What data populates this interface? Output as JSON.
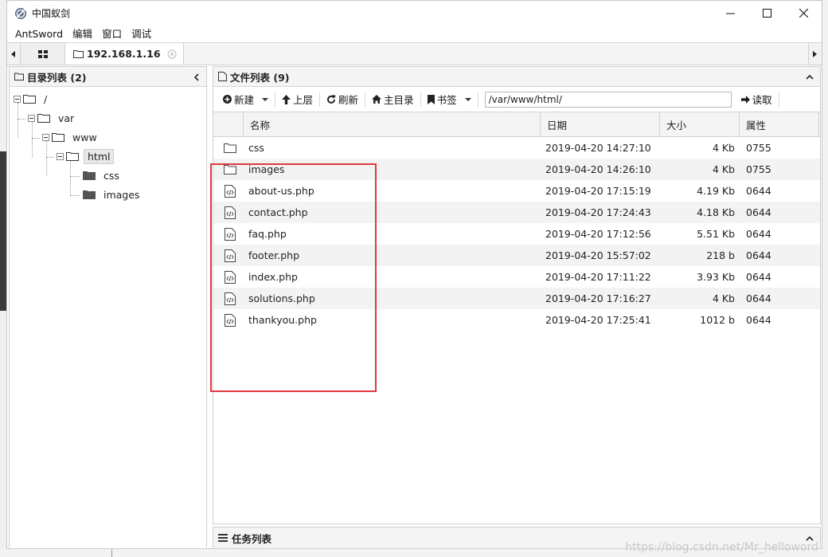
{
  "window": {
    "title": "中国蚁剑"
  },
  "menu": [
    "AntSword",
    "编辑",
    "窗口",
    "调试"
  ],
  "tab": {
    "label": "192.168.1.16"
  },
  "left_pane": {
    "title": "目录列表 (2)",
    "tree": [
      {
        "label": "/"
      },
      {
        "label": "var"
      },
      {
        "label": "www"
      },
      {
        "label": "html"
      },
      {
        "label": "css"
      },
      {
        "label": "images"
      }
    ]
  },
  "right_pane": {
    "title": "文件列表 (9)",
    "toolbar": {
      "new": "新建",
      "up": "上层",
      "refresh": "刷新",
      "home": "主目录",
      "bookmark": "书签",
      "path": "/var/www/html/",
      "read": "读取"
    },
    "columns": {
      "name": "名称",
      "date": "日期",
      "size": "大小",
      "perm": "属性"
    },
    "rows": [
      {
        "icon": "folder-icon",
        "name": "css",
        "date": "2019-04-20 14:27:10",
        "size": "4 Kb",
        "perm": "0755"
      },
      {
        "icon": "folder-icon",
        "name": "images",
        "date": "2019-04-20 14:26:10",
        "size": "4 Kb",
        "perm": "0755"
      },
      {
        "icon": "code-file-icon",
        "name": "about-us.php",
        "date": "2019-04-20 17:15:19",
        "size": "4.19 Kb",
        "perm": "0644"
      },
      {
        "icon": "code-file-icon",
        "name": "contact.php",
        "date": "2019-04-20 17:24:43",
        "size": "4.18 Kb",
        "perm": "0644"
      },
      {
        "icon": "code-file-icon",
        "name": "faq.php",
        "date": "2019-04-20 17:12:56",
        "size": "5.51 Kb",
        "perm": "0644"
      },
      {
        "icon": "code-file-icon",
        "name": "footer.php",
        "date": "2019-04-20 15:57:02",
        "size": "218 b",
        "perm": "0644"
      },
      {
        "icon": "code-file-icon",
        "name": "index.php",
        "date": "2019-04-20 17:11:22",
        "size": "3.93 Kb",
        "perm": "0644"
      },
      {
        "icon": "code-file-icon",
        "name": "solutions.php",
        "date": "2019-04-20 17:16:27",
        "size": "4 Kb",
        "perm": "0644"
      },
      {
        "icon": "code-file-icon",
        "name": "thankyou.php",
        "date": "2019-04-20 17:25:41",
        "size": "1012 b",
        "perm": "0644"
      }
    ]
  },
  "task_pane": {
    "title": "任务列表"
  },
  "watermark": "https://blog.csdn.net/Mr_helloword",
  "colors": {
    "highlight_box": "#e0393e"
  }
}
